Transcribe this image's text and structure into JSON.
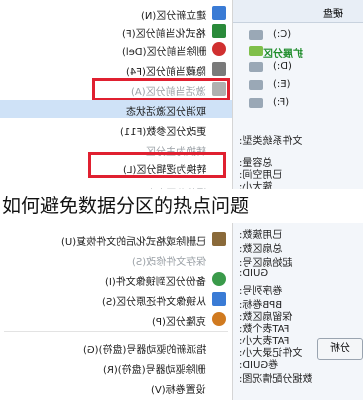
{
  "caption": "如何避免数据分区的热点问题",
  "menu": {
    "items": [
      {
        "label": "建立新分区(N)",
        "icon": "new-partition-icon",
        "color": "#3a7bd5"
      },
      {
        "label": "格式化当前分区(F)",
        "icon": "format-icon",
        "color": "#2a8a3a"
      },
      {
        "label": "删除当前分区(Del)",
        "icon": "delete-icon",
        "color": "#d03030"
      },
      {
        "label": "隐藏当前分区(F4)",
        "icon": "hide-icon",
        "color": "#7a7a7a"
      },
      {
        "label": "激活当前分区(A)",
        "icon": "activate-icon",
        "color": "#b0b0b0"
      },
      {
        "label": "取消分区激活状态",
        "icon": "none",
        "color": ""
      },
      {
        "label": "更改分区参数(F11)",
        "icon": "none",
        "color": ""
      },
      {
        "label": "转换为主分区",
        "icon": "none",
        "color": ""
      },
      {
        "label": "转换为逻辑分区(L)",
        "icon": "none",
        "color": ""
      },
      {
        "label": "调整分区大小(Ctrl+F11)",
        "icon": "none",
        "color": ""
      },
      {
        "label": "已删除或格式化后的文件恢复(U)",
        "icon": "recover-icon",
        "color": "#8a6a3a"
      },
      {
        "label": "保存文件修改(S)",
        "icon": "none",
        "color": ""
      },
      {
        "label": "备份分区到镜像文件(I)",
        "icon": "backup-icon",
        "color": "#3a9a4a"
      },
      {
        "label": "从镜像文件还原分区(S)",
        "icon": "restore-icon",
        "color": "#3a7bd5"
      },
      {
        "label": "克隆分区(P)",
        "icon": "clone-icon",
        "color": "#d07a20"
      },
      {
        "label": "指派新的驱动器号(盘符)(G)",
        "icon": "none",
        "color": ""
      },
      {
        "label": "删除驱动器号(盘符)(R)",
        "icon": "none",
        "color": ""
      },
      {
        "label": "设置卷标(V)",
        "icon": "none",
        "color": ""
      }
    ]
  },
  "right_panel": {
    "header": "硬盘",
    "tree": [
      "(C:)",
      "扩展分区",
      "(D:)",
      "(E:)",
      "(F:)"
    ],
    "props": [
      "文件系统类型:",
      "总容量:",
      "已用空间:",
      "簇大小:",
      "已用簇数:",
      "总扇区数:",
      "起始扇区号:",
      "GUID:",
      "卷序列号:",
      "BPB卷标:",
      "保留扇区数:",
      "FAT表个数:",
      "FAT表大小:",
      "文件记录大小:",
      "卷GUID:",
      "数据分配情况图:"
    ],
    "analyze_button": "分析"
  },
  "colors": {
    "highlight_red": "#e02030",
    "selection": "#cfe2f7"
  }
}
